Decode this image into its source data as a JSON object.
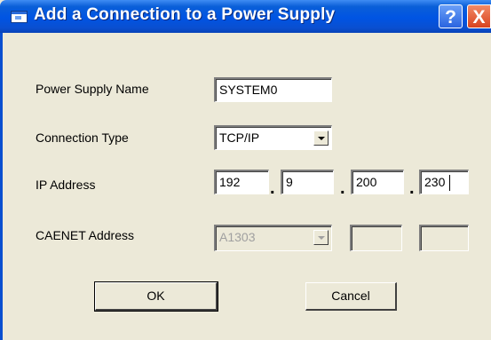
{
  "window": {
    "title": "Add a Connection to a Power Supply",
    "help_label": "?",
    "close_label": "X"
  },
  "form": {
    "name_label": "Power Supply  Name",
    "name_value": "SYSTEM0",
    "type_label": "Connection Type",
    "type_value": "TCP/IP",
    "ip_label": "IP Address",
    "ip": [
      "192",
      "9",
      "200",
      "230"
    ],
    "ip_separator": ".",
    "caenet_label": "CAENET Address",
    "caenet_value": "A1303",
    "caenet_field2": "",
    "caenet_field3": ""
  },
  "buttons": {
    "ok": "OK",
    "cancel": "Cancel"
  }
}
